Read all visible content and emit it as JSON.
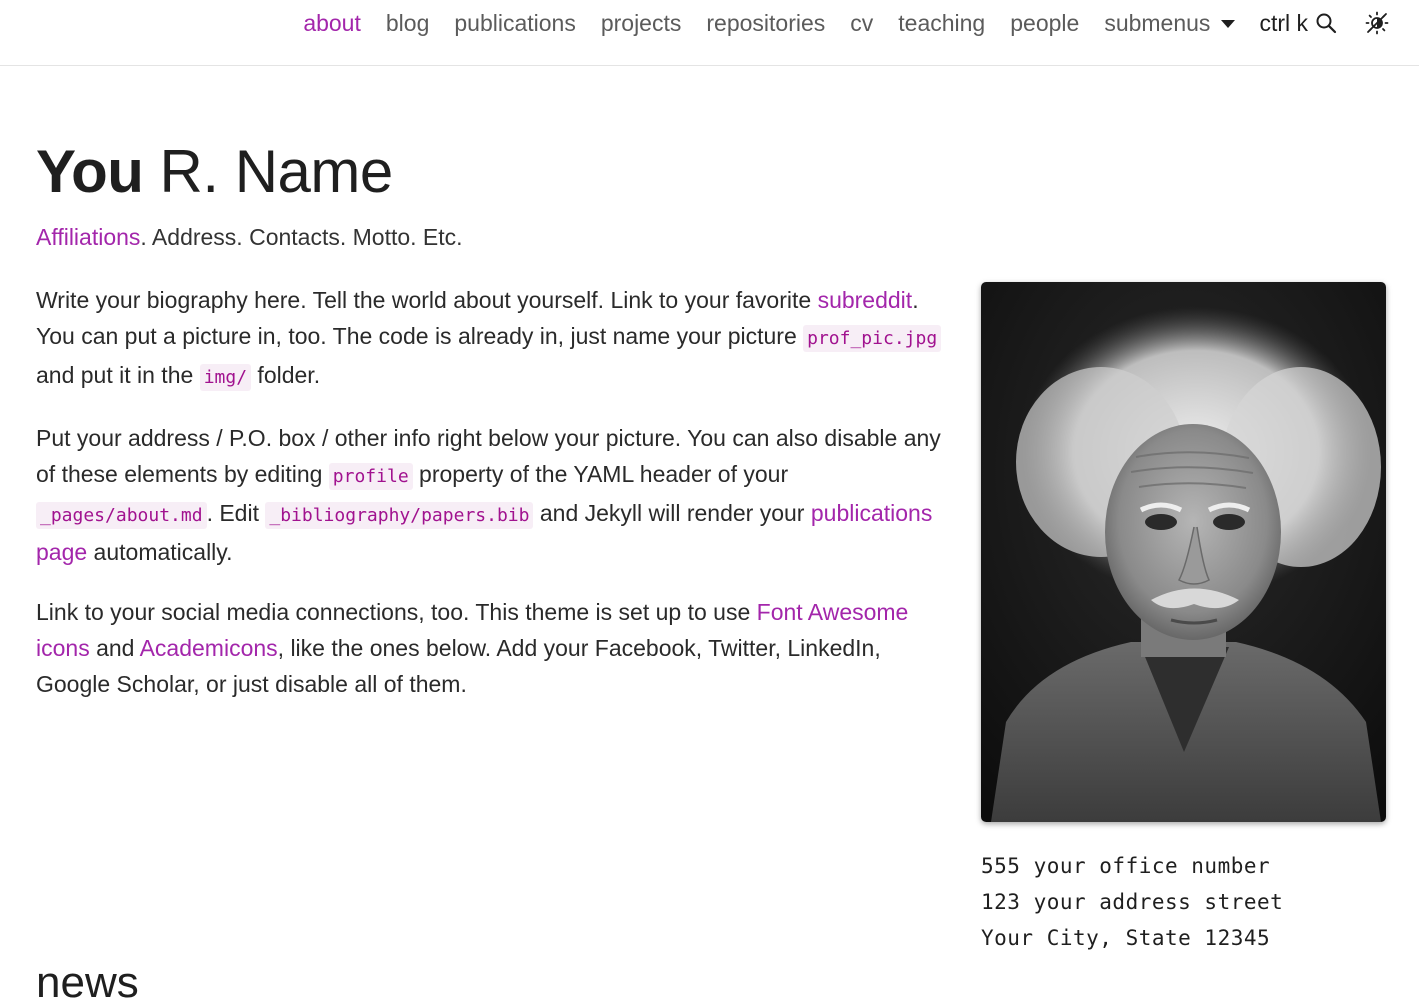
{
  "nav": {
    "items": [
      {
        "label": "about",
        "active": true
      },
      {
        "label": "blog"
      },
      {
        "label": "publications"
      },
      {
        "label": "projects"
      },
      {
        "label": "repositories"
      },
      {
        "label": "cv"
      },
      {
        "label": "teaching"
      },
      {
        "label": "people"
      }
    ],
    "submenus_label": "submenus",
    "search_label": "ctrl k",
    "search_icon": "search-icon",
    "theme_icon": "theme-toggle-icon",
    "active_color": "#a326ab"
  },
  "header": {
    "first_name": "You",
    "rest_name": " R. Name"
  },
  "subtitle": {
    "link": "Affiliations",
    "rest": ". Address. Contacts. Motto. Etc."
  },
  "bio": {
    "p1": {
      "t1": "Write your biography here. Tell the world about yourself. Link to your favorite ",
      "link": "subreddit",
      "t2": ". You can put a picture in, too. The code is already in, just name your picture ",
      "code1": "prof_pic.jpg",
      "t3": " and put it in the ",
      "code2": "img/",
      "t4": " folder."
    },
    "p2": {
      "t1": "Put your address / P.O. box / other info right below your picture. You can also disable any of these elements by editing ",
      "code1": "profile",
      "t2": " property of the YAML header of your ",
      "code2": "_pages/about.md",
      "t3": ". Edit ",
      "code3": "_bibliography/papers.bib",
      "t4": " and Jekyll will render your ",
      "link": "publications page",
      "t5": " automatically."
    },
    "p3": {
      "t1": "Link to your social media connections, too. This theme is set up to use ",
      "link1": "Font Awesome icons",
      "t2": " and ",
      "link2": "Academicons",
      "t3": ", like the ones below. Add your Facebook, Twitter, LinkedIn, Google Scholar, or just disable all of them."
    }
  },
  "profile": {
    "image_name": "profile-portrait",
    "address": [
      "555 your office number",
      "123 your address street",
      "Your City, State 12345"
    ]
  },
  "news": {
    "heading": "news"
  }
}
